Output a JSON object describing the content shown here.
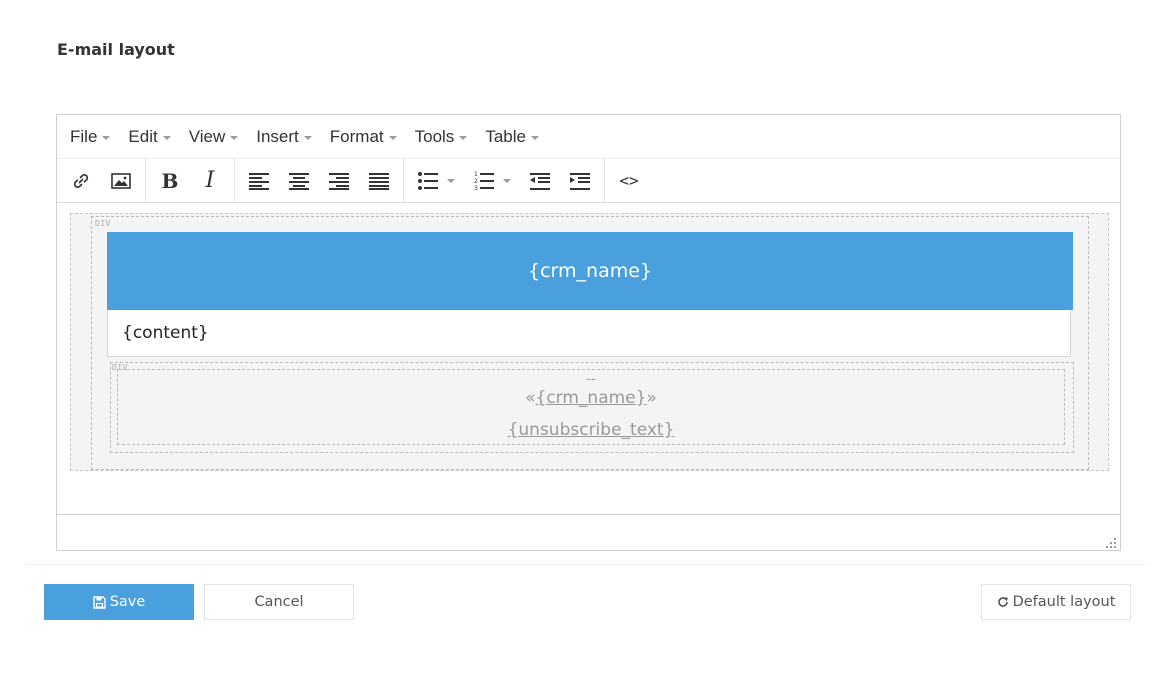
{
  "page": {
    "title": "E-mail layout"
  },
  "editor": {
    "menu": [
      {
        "label": "File"
      },
      {
        "label": "Edit"
      },
      {
        "label": "View"
      },
      {
        "label": "Insert"
      },
      {
        "label": "Format"
      },
      {
        "label": "Tools"
      },
      {
        "label": "Table"
      }
    ],
    "toolbar": {
      "bold_glyph": "B",
      "italic_glyph": "I",
      "code_glyph": "<>",
      "icons": [
        "link-icon",
        "image-icon",
        "bold-icon",
        "italic-icon",
        "align-left-icon",
        "align-center-icon",
        "align-right-icon",
        "align-justify-icon",
        "bullet-list-icon",
        "numbered-list-icon",
        "outdent-icon",
        "indent-icon",
        "source-code-icon"
      ]
    },
    "content": {
      "div_tag": "DIV",
      "header_text": "{crm_name}",
      "body_text": "{content}",
      "footer": {
        "dash": "--",
        "open_quote": "«",
        "name": "{crm_name}",
        "close_quote": "»",
        "unsubscribe": "{unsubscribe_text}"
      }
    },
    "colors": {
      "header_bg": "#4aa0dd",
      "primary": "#4aa0dd"
    }
  },
  "actions": {
    "save_label": "Save",
    "cancel_label": "Cancel",
    "default_label": "Default layout"
  }
}
